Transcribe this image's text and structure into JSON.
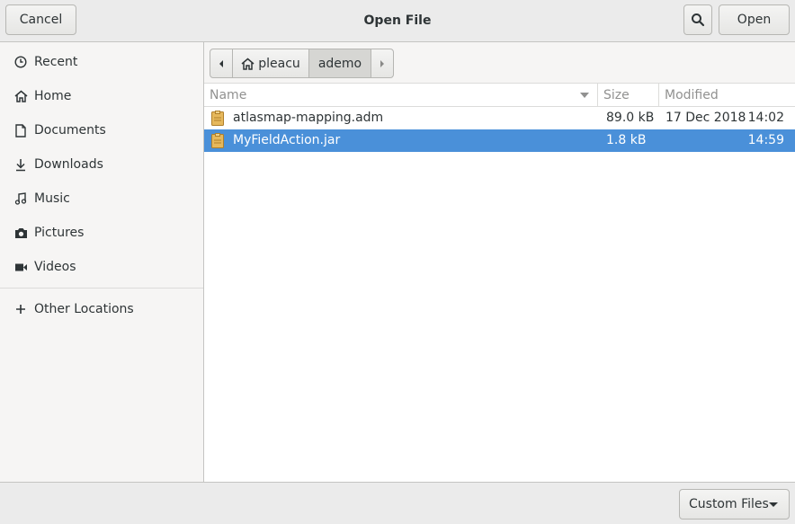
{
  "header": {
    "title": "Open File",
    "cancel_label": "Cancel",
    "open_label": "Open",
    "search_icon": "search-icon"
  },
  "sidebar": {
    "items": [
      {
        "label": "Recent",
        "icon": "clock-icon"
      },
      {
        "label": "Home",
        "icon": "home-icon"
      },
      {
        "label": "Documents",
        "icon": "document-icon"
      },
      {
        "label": "Downloads",
        "icon": "download-icon"
      },
      {
        "label": "Music",
        "icon": "music-icon"
      },
      {
        "label": "Pictures",
        "icon": "camera-icon"
      },
      {
        "label": "Videos",
        "icon": "video-icon"
      },
      {
        "label": "Other Locations",
        "icon": "plus-icon"
      }
    ]
  },
  "pathbar": {
    "segments": [
      "pleacu",
      "ademo"
    ],
    "active": "ademo"
  },
  "filelist": {
    "columns": {
      "name": "Name",
      "size": "Size",
      "modified": "Modified"
    },
    "rows": [
      {
        "name": "atlasmap-mapping.adm",
        "size": "89.0 kB",
        "date": "17 Dec 2018",
        "time": "14:02",
        "selected": false
      },
      {
        "name": "MyFieldAction.jar",
        "size": "1.8 kB",
        "date": "",
        "time": "14:59",
        "selected": true
      }
    ]
  },
  "footer": {
    "filter_label": "Custom Files"
  },
  "colors": {
    "selection": "#4a90d9",
    "headerbar": "#ebebeb",
    "sidebar": "#f6f5f4",
    "file_icon": "#e6b85c"
  }
}
